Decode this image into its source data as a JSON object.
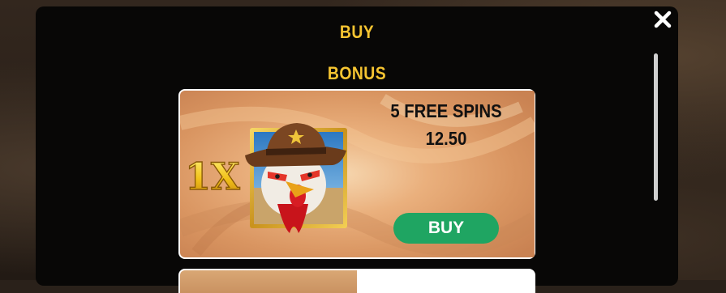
{
  "modal": {
    "title": "BUY",
    "section_title": "BONUS",
    "close_icon": "close-icon"
  },
  "offer": {
    "multiplier_badge": "1X",
    "spins_label": "5 FREE SPINS",
    "price": "12.50",
    "buy_label": "BUY",
    "image_icon": "sheriff-rooster-symbol"
  },
  "colors": {
    "accent_gold": "#f5c431",
    "buy_green": "#1fa562",
    "modal_bg": "#080706"
  }
}
